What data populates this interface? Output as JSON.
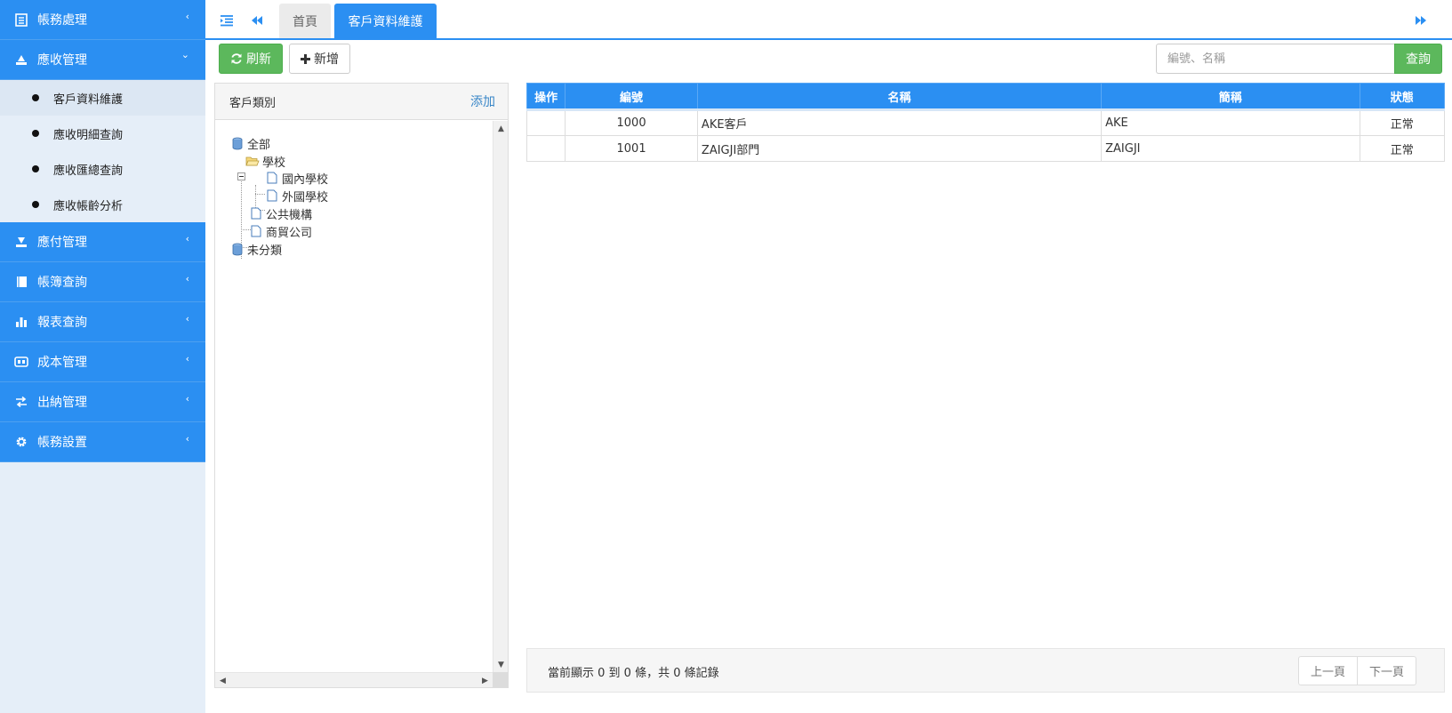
{
  "sidebar": {
    "items": [
      {
        "label": "帳務處理",
        "icon": "list-icon",
        "arrow": "‹"
      },
      {
        "label": "應收管理",
        "icon": "receivable-icon",
        "arrow": "⌄"
      },
      {
        "label": "應付管理",
        "icon": "payable-icon",
        "arrow": "‹"
      },
      {
        "label": "帳簿查詢",
        "icon": "book-icon",
        "arrow": "‹"
      },
      {
        "label": "報表查詢",
        "icon": "bar-chart-icon",
        "arrow": "‹"
      },
      {
        "label": "成本管理",
        "icon": "cost-icon",
        "arrow": "‹"
      },
      {
        "label": "出納管理",
        "icon": "exchange-icon",
        "arrow": "‹"
      },
      {
        "label": "帳務設置",
        "icon": "gear-icon",
        "arrow": "‹"
      }
    ],
    "submenu": [
      {
        "label": "客戶資料維護",
        "active": true
      },
      {
        "label": "應收明細查詢"
      },
      {
        "label": "應收匯總查詢"
      },
      {
        "label": "應收帳齡分析"
      }
    ]
  },
  "topbar": {
    "tabs": [
      {
        "label": "首頁"
      },
      {
        "label": "客戶資料維護",
        "active": true
      }
    ]
  },
  "toolbar": {
    "refresh_label": "刷新",
    "add_label": "新增",
    "search_placeholder": "編號、名稱",
    "search_value": "",
    "search_label": "查詢"
  },
  "category": {
    "title": "客戶類別",
    "add_label": "添加",
    "tree": {
      "all": "全部",
      "school": "學校",
      "domestic_school": "國內學校",
      "foreign_school": "外國學校",
      "public_agency": "公共機構",
      "trading_company": "商貿公司",
      "uncategorized": "未分類"
    }
  },
  "table": {
    "columns": [
      "操作",
      "編號",
      "名稱",
      "簡稱",
      "狀態"
    ],
    "rows": [
      {
        "op": "",
        "code": "1000",
        "name": "AKE客戶",
        "abbr": "AKE",
        "status": "正常"
      },
      {
        "op": "",
        "code": "1001",
        "name": "ZAIGJI部門",
        "abbr": "ZAIGJI",
        "status": "正常"
      }
    ]
  },
  "pager": {
    "info": "當前顯示 0 到 0 條，共 0 條記錄",
    "prev_label": "上一頁",
    "next_label": "下一頁"
  },
  "colors": {
    "primary": "#2b8ff2",
    "success": "#5cb85c",
    "sidebar_bg": "#e5eef8",
    "link": "#3a87c8"
  }
}
